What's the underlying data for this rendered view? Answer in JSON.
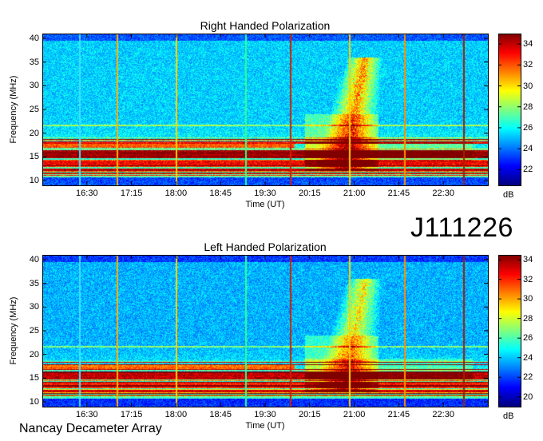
{
  "event_id": "J111226",
  "footer": "Nancay Decameter Array",
  "colors": {
    "frame": "#000000",
    "background": "#ffffff"
  },
  "chart_data": [
    {
      "type": "heatmap",
      "title": "Right Handed Polarization",
      "xlabel": "Time (UT)",
      "ylabel": "Frequency (MHz)",
      "x_ticks": [
        "16:30",
        "17:15",
        "18:00",
        "18:45",
        "19:30",
        "20:15",
        "21:00",
        "21:45",
        "22:30"
      ],
      "x_range": [
        "15:45",
        "23:15"
      ],
      "y_ticks": [
        10,
        15,
        20,
        25,
        30,
        35,
        40
      ],
      "ylim": [
        9,
        41
      ],
      "colorbar": {
        "label": "dB",
        "ticks": [
          22,
          24,
          26,
          28,
          30,
          32,
          34
        ],
        "range": [
          20.5,
          35
        ]
      },
      "features": [
        {
          "kind": "burst",
          "start": "20:10",
          "peak": "20:55",
          "end": "21:25",
          "freq_low": 12,
          "freq_high": 36
        },
        {
          "kind": "interference-band",
          "freq": 15.5
        },
        {
          "kind": "interference-band",
          "freq": 13.5
        }
      ]
    },
    {
      "type": "heatmap",
      "title": "Left Handed Polarization",
      "xlabel": "Time (UT)",
      "ylabel": "Frequency (MHz)",
      "x_ticks": [
        "16:30",
        "17:15",
        "18:00",
        "18:45",
        "19:30",
        "20:15",
        "21:00",
        "21:45",
        "22:30"
      ],
      "x_range": [
        "15:45",
        "23:15"
      ],
      "y_ticks": [
        10,
        15,
        20,
        25,
        30,
        35,
        40
      ],
      "ylim": [
        9,
        41
      ],
      "colorbar": {
        "label": "dB",
        "ticks": [
          20,
          22,
          24,
          26,
          28,
          30,
          32,
          34
        ],
        "range": [
          19,
          34.5
        ]
      },
      "features": [
        {
          "kind": "burst",
          "start": "20:10",
          "peak": "20:55",
          "end": "21:25",
          "freq_low": 12,
          "freq_high": 36
        },
        {
          "kind": "interference-band",
          "freq": 15.5
        },
        {
          "kind": "interference-band",
          "freq": 13.5
        }
      ]
    }
  ]
}
